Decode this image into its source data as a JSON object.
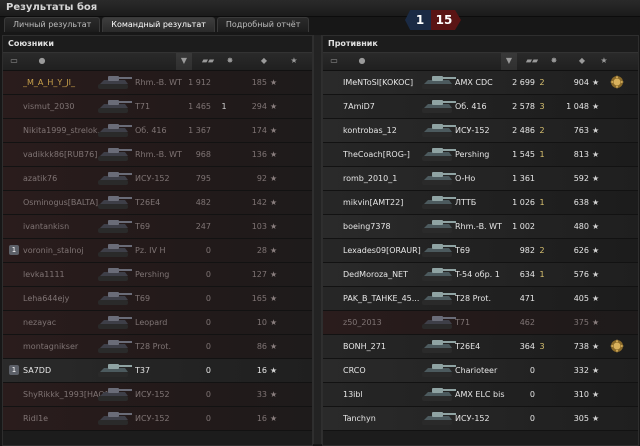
{
  "window": {
    "title": "Результаты боя"
  },
  "tabs": [
    {
      "label": "Личный результат",
      "active": false
    },
    {
      "label": "Командный результат",
      "active": true
    },
    {
      "label": "Подробный отчёт",
      "active": false
    }
  ],
  "score": {
    "allies": "1",
    "enemies": "15"
  },
  "allies": {
    "title": "Союзники",
    "header_icons": [
      "platoon-icon",
      "player-icon",
      "sort-arrow-icon",
      "tank-icon",
      "damage-icon",
      "kills-icon",
      "xp-star-icon"
    ],
    "rows": [
      {
        "name": "_M_A_H_Y_JI_",
        "tank": "Rhm.-B. WT",
        "damage": "1 912",
        "kills": "",
        "xp": "185",
        "alive": false,
        "self": true,
        "platoon": ""
      },
      {
        "name": "vismut_2030",
        "tank": "T71",
        "damage": "1 465",
        "kills": "1",
        "xp": "294",
        "alive": false,
        "self": false,
        "platoon": ""
      },
      {
        "name": "Nikita1999_strelok...",
        "tank": "Об. 416",
        "damage": "1 367",
        "kills": "",
        "xp": "174",
        "alive": false,
        "self": false,
        "platoon": ""
      },
      {
        "name": "vadikkk86[RUB76]",
        "tank": "Rhm.-B. WT",
        "damage": "968",
        "kills": "",
        "xp": "136",
        "alive": false,
        "self": false,
        "platoon": ""
      },
      {
        "name": "azatik76",
        "tank": "ИСУ-152",
        "damage": "795",
        "kills": "",
        "xp": "92",
        "alive": false,
        "self": false,
        "platoon": ""
      },
      {
        "name": "Osminogus[BALTA]",
        "tank": "T26E4",
        "damage": "482",
        "kills": "",
        "xp": "142",
        "alive": false,
        "self": false,
        "platoon": ""
      },
      {
        "name": "ivantankisn",
        "tank": "T69",
        "damage": "247",
        "kills": "",
        "xp": "103",
        "alive": false,
        "self": false,
        "platoon": ""
      },
      {
        "name": "voronin_stalnoj",
        "tank": "Pz. IV H",
        "damage": "0",
        "kills": "",
        "xp": "28",
        "alive": false,
        "self": false,
        "platoon": "1"
      },
      {
        "name": "levka1111",
        "tank": "Pershing",
        "damage": "0",
        "kills": "",
        "xp": "127",
        "alive": false,
        "self": false,
        "platoon": ""
      },
      {
        "name": "Leha644ejy",
        "tank": "T69",
        "damage": "0",
        "kills": "",
        "xp": "165",
        "alive": false,
        "self": false,
        "platoon": ""
      },
      {
        "name": "nezayac",
        "tank": "Leopard",
        "damage": "0",
        "kills": "",
        "xp": "10",
        "alive": false,
        "self": false,
        "platoon": ""
      },
      {
        "name": "montagnikser",
        "tank": "T28 Prot.",
        "damage": "0",
        "kills": "",
        "xp": "86",
        "alive": false,
        "self": false,
        "platoon": ""
      },
      {
        "name": "SA7DD",
        "tank": "T37",
        "damage": "0",
        "kills": "",
        "xp": "16",
        "alive": true,
        "self": false,
        "platoon": "1"
      },
      {
        "name": "ShyRikkk_1993[HAO]",
        "tank": "ИСУ-152",
        "damage": "0",
        "kills": "",
        "xp": "33",
        "alive": false,
        "self": false,
        "platoon": ""
      },
      {
        "name": "Ridl1e",
        "tank": "ИСУ-152",
        "damage": "0",
        "kills": "",
        "xp": "16",
        "alive": false,
        "self": false,
        "platoon": ""
      }
    ]
  },
  "enemies": {
    "title": "Противник",
    "header_icons": [
      "platoon-icon",
      "player-icon",
      "sort-arrow-icon",
      "tank-icon",
      "damage-icon",
      "kills-icon",
      "xp-star-icon"
    ],
    "rows": [
      {
        "name": "IMeNToSI[KOKOC]",
        "tank": "AMX CDC",
        "damage": "2 699",
        "kills": "2",
        "xp": "904",
        "alive": true,
        "medal": true
      },
      {
        "name": "7AmiD7",
        "tank": "Об. 416",
        "damage": "2 578",
        "kills": "3",
        "xp": "1 048",
        "alive": true,
        "medal": false
      },
      {
        "name": "kontrobas_12",
        "tank": "ИСУ-152",
        "damage": "2 486",
        "kills": "2",
        "xp": "763",
        "alive": true,
        "medal": false
      },
      {
        "name": "TheCoach[ROG-]",
        "tank": "Pershing",
        "damage": "1 545",
        "kills": "1",
        "xp": "813",
        "alive": true,
        "medal": false
      },
      {
        "name": "romb_2010_1",
        "tank": "O-Ho",
        "damage": "1 361",
        "kills": "",
        "xp": "592",
        "alive": true,
        "medal": false
      },
      {
        "name": "mikvin[AMT22]",
        "tank": "ЛТТБ",
        "damage": "1 026",
        "kills": "1",
        "xp": "638",
        "alive": true,
        "medal": false
      },
      {
        "name": "boeing7378",
        "tank": "Rhm.-B. WT",
        "damage": "1 002",
        "kills": "",
        "xp": "480",
        "alive": true,
        "medal": false
      },
      {
        "name": "Lexades09[ORAUR]",
        "tank": "T69",
        "damage": "982",
        "kills": "2",
        "xp": "626",
        "alive": true,
        "medal": false
      },
      {
        "name": "DedMoroza_NET",
        "tank": "T-54 обр. 1",
        "damage": "634",
        "kills": "1",
        "xp": "576",
        "alive": true,
        "medal": false
      },
      {
        "name": "PAK_B_TAHKE_45...",
        "tank": "T28 Prot.",
        "damage": "471",
        "kills": "",
        "xp": "405",
        "alive": true,
        "medal": false
      },
      {
        "name": "z50_2013",
        "tank": "T71",
        "damage": "462",
        "kills": "",
        "xp": "375",
        "alive": false,
        "medal": false
      },
      {
        "name": "BONH_271",
        "tank": "T26E4",
        "damage": "364",
        "kills": "3",
        "xp": "738",
        "alive": true,
        "medal": true
      },
      {
        "name": "CRCO",
        "tank": "Charioteer",
        "damage": "0",
        "kills": "",
        "xp": "332",
        "alive": true,
        "medal": false
      },
      {
        "name": "13ibl",
        "tank": "AMX ELC bis",
        "damage": "0",
        "kills": "",
        "xp": "310",
        "alive": true,
        "medal": false
      },
      {
        "name": "Tanchyn",
        "tank": "ИСУ-152",
        "damage": "0",
        "kills": "",
        "xp": "305",
        "alive": true,
        "medal": false
      }
    ]
  },
  "colors": {
    "kills": "#d9c271",
    "alive_text": "#e6e6e6",
    "dead_text": "#7f7474",
    "score_allies": "#1a2a44",
    "score_enemies": "#5a1414"
  },
  "star_glyph": "★"
}
